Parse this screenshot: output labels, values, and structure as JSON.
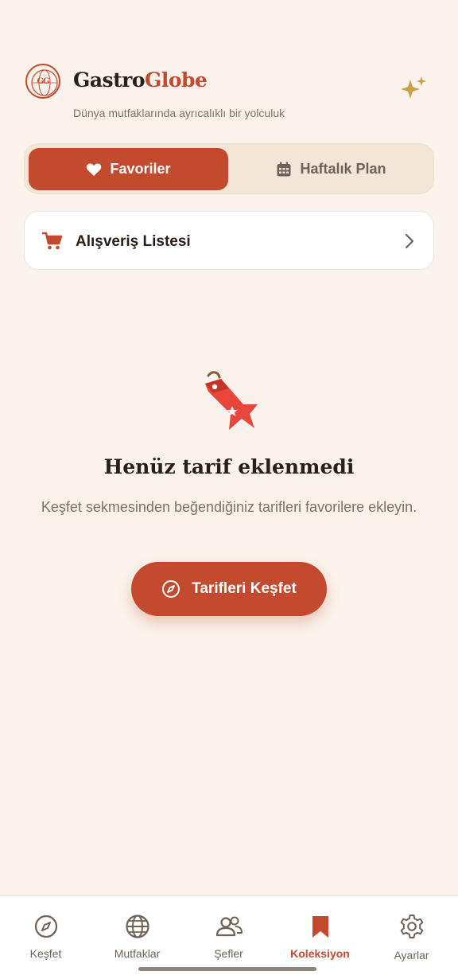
{
  "app": {
    "logo_text": "GG",
    "brand_part1": "Gastro",
    "brand_part2": "Globe",
    "tagline": "Dünya mutfaklarında ayrıcalıklı bir yolculuk"
  },
  "segment": {
    "active_label": "Favoriler",
    "inactive_label": "Haftalık Plan",
    "active_icon": "heart-icon",
    "inactive_icon": "calendar-icon"
  },
  "shopping": {
    "label": "Alışveriş Listesi",
    "icon": "cart-icon"
  },
  "empty_state": {
    "title": "Henüz tarif eklenmedi",
    "description": "Keşfet sekmesinden beğendiğiniz tarifleri favorilere ekleyin.",
    "cta_label": "Tarifleri Keşfet",
    "cta_icon": "compass-icon",
    "illustration": "bookmark-tag-icon"
  },
  "bottom_nav": {
    "items": [
      {
        "label": "Keşfet",
        "icon": "compass-icon",
        "active": false
      },
      {
        "label": "Mutfaklar",
        "icon": "globe-icon",
        "active": false
      },
      {
        "label": "Şefler",
        "icon": "people-icon",
        "active": false
      },
      {
        "label": "Koleksiyon",
        "icon": "bookmark-icon",
        "active": true
      },
      {
        "label": "Ayarlar",
        "icon": "gear-icon",
        "active": false
      }
    ]
  },
  "colors": {
    "accent": "#c44a2f",
    "background": "#faf3ec",
    "segment_bg": "#f3e6d7",
    "gold": "#c9a24a"
  }
}
